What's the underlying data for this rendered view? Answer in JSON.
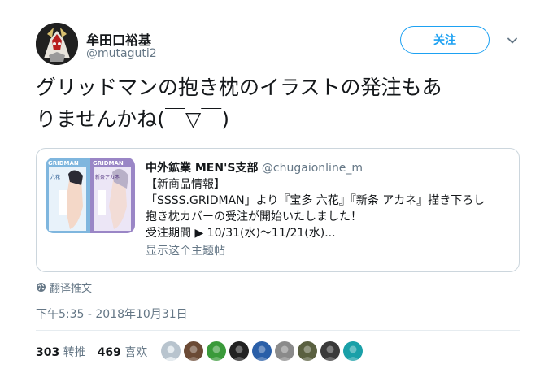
{
  "author": {
    "display_name": "牟田口裕基",
    "handle": "@mutaguti2"
  },
  "follow_label": "关注",
  "tweet": {
    "line1": "グリッドマンの抱き枕のイラストの発注もあ",
    "line2": "りませんかね(￣▽￣)"
  },
  "quote": {
    "author_name": "中外鉱業 MEN'S支部",
    "author_handle": "@chugaionline_m",
    "thumb_labels": [
      "GRIDMAN",
      "GRIDMAN",
      "六花",
      "新条アカネ"
    ],
    "lines": [
      "【新商品情報】",
      "「SSSS.GRIDMAN」より『宝多 六花』『新条 アカネ』描き下ろし",
      "抱き枕カバーの受注が開始いたしました！",
      "受注期間 ▶ 10/31(水)〜11/21(水)..."
    ],
    "show_thread": "显示这个主题帖"
  },
  "translate_label": "翻译推文",
  "timestamp": "下午5:35 - 2018年10月31日",
  "stats": {
    "retweets": "303",
    "retweets_label": "转推",
    "likes": "469",
    "likes_label": "喜欢"
  },
  "colors": {
    "accent": "#1da1f2",
    "secondary_text": "#657786",
    "primary_text": "#14171a",
    "border": "#ccd6dd"
  },
  "liker_avatars": [
    {
      "icon": "default-user-icon",
      "color": "#b8c4ce"
    },
    {
      "icon": "avatar-brown",
      "color": "#6b4a35"
    },
    {
      "icon": "avatar-green",
      "color": "#3a9a3a"
    },
    {
      "icon": "avatar-dark",
      "color": "#222222"
    },
    {
      "icon": "avatar-blue",
      "color": "#2a5fa8"
    },
    {
      "icon": "avatar-gray",
      "color": "#8a8a8a"
    },
    {
      "icon": "avatar-olive",
      "color": "#5a6040"
    },
    {
      "icon": "avatar-black-white",
      "color": "#3a3a3a"
    },
    {
      "icon": "avatar-teal-red",
      "color": "#1aa0a8"
    }
  ]
}
